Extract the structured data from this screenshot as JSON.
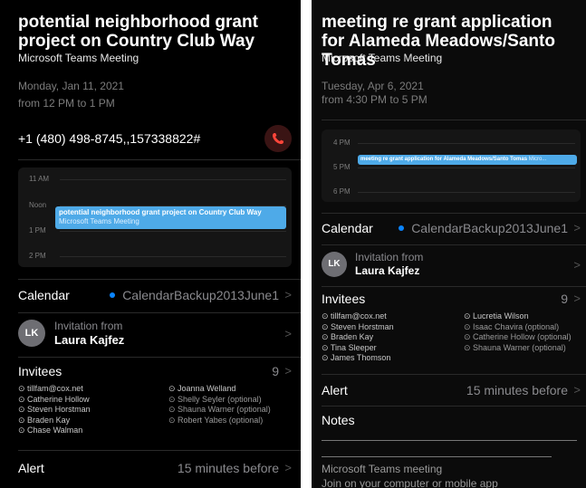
{
  "left": {
    "title": "potential neighborhood grant project on Country Club Way",
    "subtitle": "Microsoft Teams Meeting",
    "date": "Monday, Jan 11, 2021",
    "time": "from 12 PM to 1 PM",
    "phone": "+1 (480) 498-8745,,157338822#",
    "timeline": {
      "labels": [
        "11 AM",
        "Noon",
        "1 PM",
        "2 PM"
      ],
      "event_title": "potential neighborhood grant project on Country Club Way",
      "event_sub": "Microsoft Teams Meeting"
    },
    "calendar_label": "Calendar",
    "calendar_value": "CalendarBackup2013June1",
    "invitation_from": "Invitation from",
    "organizer": "Laura Kajfez",
    "avatar_initials": "LK",
    "invitees_label": "Invitees",
    "invitees_count": "9",
    "invitees_col1": [
      "tillfam@cox.net",
      "Catherine Hollow",
      "Steven Horstman",
      "Braden Kay",
      "Chase Walman"
    ],
    "invitees_col2": [
      "Joanna Welland",
      "Shelly Seyler (optional)",
      "Shauna Warner (optional)",
      "Robert Yabes (optional)"
    ],
    "alert_label": "Alert",
    "alert_value": "15 minutes before"
  },
  "right": {
    "title": "meeting re grant application for Alameda Meadows/Santo Tomas",
    "subtitle": "Microsoft Teams Meeting",
    "date": "Tuesday, Apr 6, 2021",
    "time": "from 4:30 PM to 5 PM",
    "timeline": {
      "labels": [
        "4 PM",
        "5 PM",
        "6 PM"
      ],
      "event_title": "meeting re grant application for Alameda Meadows/Santo Tomas",
      "event_sub": "Micro..."
    },
    "calendar_label": "Calendar",
    "calendar_value": "CalendarBackup2013June1",
    "invitation_from": "Invitation from",
    "organizer": "Laura Kajfez",
    "avatar_initials": "LK",
    "invitees_label": "Invitees",
    "invitees_count": "9",
    "invitees_col1": [
      "tillfam@cox.net",
      "Steven Horstman",
      "Braden Kay",
      "Tina Sleeper",
      "James Thomson"
    ],
    "invitees_col2": [
      "Lucretia Wilson",
      "Isaac Chavira (optional)",
      "Catherine Hollow (optional)",
      "Shauna Warner (optional)"
    ],
    "alert_label": "Alert",
    "alert_value": "15 minutes before",
    "notes_label": "Notes",
    "teams_heading": "Microsoft Teams meeting",
    "teams_join": "Join on your computer or mobile app"
  },
  "icons": {
    "phone": "phone-icon",
    "chevron": "chevron-right-icon",
    "invitee": "invitee-status-icon"
  },
  "colors": {
    "event": "#4eaae8",
    "call_button": "#3a1414",
    "call_icon": "#ff453a",
    "calendar_dot": "#0a84ff"
  }
}
